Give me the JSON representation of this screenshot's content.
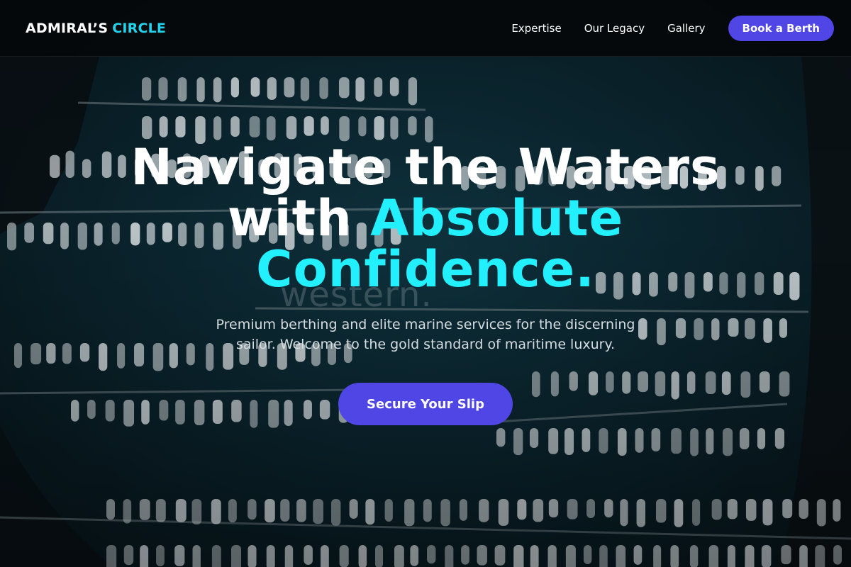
{
  "brand": {
    "name_part1": "ADMIRAL’S",
    "name_part2": "CIRCLE"
  },
  "nav": {
    "links": [
      "Expertise",
      "Our Legacy",
      "Gallery"
    ],
    "cta_label": "Book a Berth"
  },
  "hero": {
    "headline_line1": "Navigate the Waters",
    "headline_line2_prefix": "with",
    "headline_accent_1": "Absolute",
    "headline_accent_2": "Confidence.",
    "subtext": "Premium berthing and elite marine services for the discerning sailor. Welcome to the gold standard of maritime luxury.",
    "cta_label": "Secure Your Slip",
    "background_watermark": "western."
  },
  "colors": {
    "accent_cyan": "#22d3ee",
    "headline_accent": "#22f0ff",
    "button_indigo": "#4f46e5",
    "header_bg": "#05080a"
  }
}
